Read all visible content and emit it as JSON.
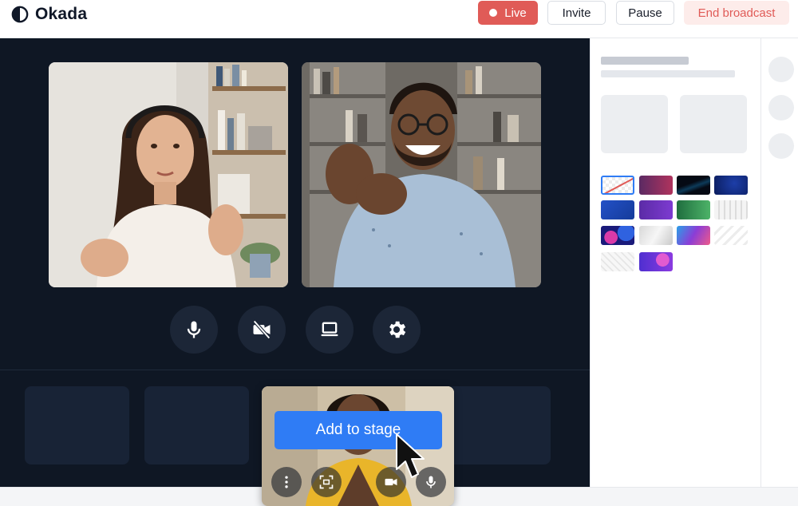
{
  "app": {
    "name": "Okada"
  },
  "header": {
    "live_label": "Live",
    "invite_label": "Invite",
    "pause_label": "Pause",
    "end_label": "End broadcast"
  },
  "stage": {
    "controls": [
      "mic-icon",
      "camera-off-icon",
      "screen-share-icon",
      "gear-icon"
    ]
  },
  "preview": {
    "add_to_stage_label": "Add to stage",
    "buttons": [
      "more-vertical-icon",
      "fullscreen-icon",
      "camera-icon",
      "mic-icon"
    ]
  },
  "panel": {
    "backgrounds": [
      "none",
      "magenta-gradient",
      "dark-wave",
      "navy-tech",
      "blue",
      "purple",
      "green",
      "white-pattern",
      "blobs",
      "silver",
      "gradient-waves",
      "white-waves",
      "light-pattern",
      "purple-abstract"
    ],
    "selected_background": "none"
  },
  "colors": {
    "accent": "#2f7cf5",
    "live": "#e05b57",
    "stage_bg": "#0f1724"
  }
}
